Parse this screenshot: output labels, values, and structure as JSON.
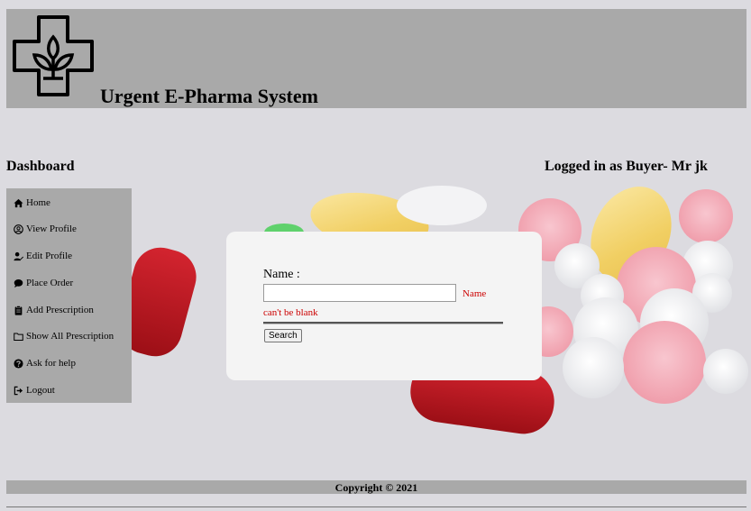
{
  "header": {
    "title": "Urgent E-Pharma System",
    "logo_icon": "pharmacy-cross-leaf-icon"
  },
  "dashboard": {
    "title": "Dashboard",
    "logged_in_text": "Logged in as Buyer- Mr jk"
  },
  "sidebar": {
    "items": [
      {
        "label": "Home",
        "icon": "home-icon"
      },
      {
        "label": "View Profile",
        "icon": "user-circle-icon"
      },
      {
        "label": "Edit Profile",
        "icon": "user-edit-icon"
      },
      {
        "label": "Place Order",
        "icon": "chat-icon"
      },
      {
        "label": "Add Prescription",
        "icon": "clipboard-icon"
      },
      {
        "label": "Show All Prescription",
        "icon": "folder-icon"
      },
      {
        "label": "Ask for help",
        "icon": "question-circle-icon"
      },
      {
        "label": "Logout",
        "icon": "sign-out-icon"
      }
    ]
  },
  "search_form": {
    "name_label": "Name :",
    "name_value": "",
    "error_part1": "Name",
    "error_part2": "can't be blank",
    "search_button": "Search"
  },
  "footer": {
    "copyright": "Copyright © 2021"
  },
  "colors": {
    "panel_gray": "#a9a9a9",
    "error_red": "#cc0000",
    "card_bg": "#f4f4f4"
  }
}
